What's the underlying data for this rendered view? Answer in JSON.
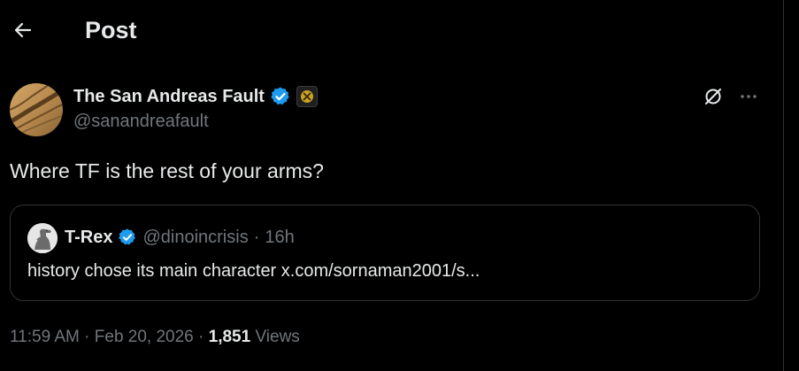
{
  "header": {
    "title": "Post",
    "back_icon": "arrow-left-icon"
  },
  "post": {
    "author": {
      "display_name": "The San Andreas Fault",
      "handle": "@sanandreafault",
      "verified": true,
      "badge_color": "#1d9bf0"
    },
    "text": "Where TF is the rest of your arms?",
    "quoted_post": {
      "display_name": "T-Rex",
      "handle": "@dinoincrisis",
      "separator": "·",
      "time": "16h",
      "text": "history chose its main character x.com/sornaman2001/s..."
    },
    "meta": {
      "time": "11:59 AM",
      "separator": "·",
      "date": "Feb 20, 2026",
      "separator2": "·",
      "views_count": "1,851",
      "views_label": "Views"
    },
    "actions": {
      "grok_icon": "grok-icon",
      "more_icon": "more-horizontal-icon"
    }
  },
  "colors": {
    "background": "#000000",
    "primary_text": "#e7e9ea",
    "secondary_text": "#71767b",
    "border": "#2f3336",
    "verified_blue": "#1d9bf0"
  }
}
